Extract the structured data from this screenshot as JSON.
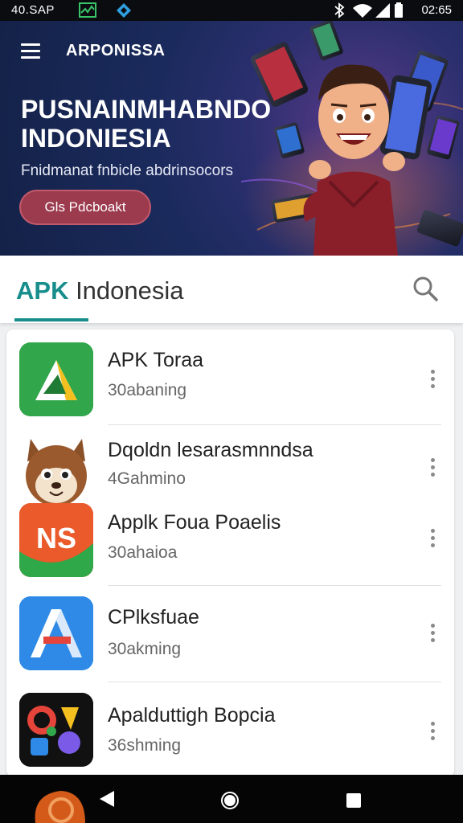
{
  "status_bar": {
    "time_left": "40.SAP",
    "time_right": "02:65"
  },
  "header": {
    "brand": "ARPONISSA",
    "hero_title": "PUSNAINMHABNDO INDONIESIA",
    "hero_subtitle": "Fnidmanat fnbicle abdrinsocors",
    "hero_button": "Gls Pdcboakt"
  },
  "app_bar": {
    "title_accent": "APK",
    "title_rest": " Indonesia"
  },
  "apps": [
    {
      "name": "APK Toraa",
      "subtitle": "30abaning",
      "icon": "green-triangle-icon"
    },
    {
      "name": "Dqoldn lesarasmnndsa",
      "subtitle": "4Gahmino",
      "icon": "mascot-face-icon"
    },
    {
      "name": "Applk Foua Poaelis",
      "subtitle": "30ahaioa",
      "icon": "ns-logo-icon"
    },
    {
      "name": "CPlksfuae",
      "subtitle": "30akming",
      "icon": "blue-a-icon"
    },
    {
      "name": "Apalduttigh Bopcia",
      "subtitle": "36shming",
      "icon": "colorful-shapes-icon"
    }
  ],
  "colors": {
    "accent": "#178e8c",
    "hero_button": "#9c3a4e",
    "hero_bg": "#1a2a5c"
  }
}
